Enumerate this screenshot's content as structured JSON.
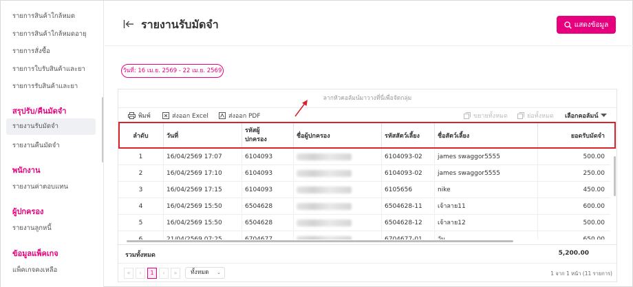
{
  "sidebar": {
    "items": [
      {
        "label": "รายการสินค้าใกล้หมด"
      },
      {
        "label": "รายการสินค้าใกล้หมดอายุ"
      },
      {
        "label": "รายการสั่งซื้อ"
      },
      {
        "label": "รายการใบรับสินค้าและยา"
      },
      {
        "label": "รายการรับสินค้าและยา"
      }
    ],
    "sections": [
      {
        "title": "สรุปรับ/คืนมัดจำ",
        "items": [
          "รายงานรับมัดจำ",
          "รายงานคืนมัดจำ"
        ]
      },
      {
        "title": "พนักงาน",
        "items": [
          "รายงานค่าตอบแทน"
        ]
      },
      {
        "title": "ผู้ปกครอง",
        "items": [
          "รายงานลูกหนี้"
        ]
      },
      {
        "title": "ข้อมูลแพ็คเกจ",
        "items": [
          "แพ็คเกจคงเหลือ"
        ]
      }
    ]
  },
  "header": {
    "title": "รายงานรับมัดจำ",
    "show_button": "แสดงข้อมูล"
  },
  "date_range": "วันที่: 16 เม.ย. 2569 - 22 เม.ย. 2569",
  "grid": {
    "group_hint": "ลากหัวคอลัมน์มาวางที่นี่เพื่อจัดกลุ่ม",
    "toolbar": {
      "print": "พิมพ์",
      "export_excel": "ส่งออก Excel",
      "export_pdf": "ส่งออก PDF",
      "expand_all": "ขยายทั้งหมด",
      "collapse_all": "ย่อทั้งหมด",
      "choose_columns": "เลือกคอลัมน์"
    },
    "columns": [
      "ลำดับ",
      "วันที่",
      "รหัสผู้ปกครอง",
      "ชื่อผู้ปกครอง",
      "รหัสสัตว์เลี้ยง",
      "ชื่อสัตว์เลี้ยง",
      "ยอดรับมัดจำ"
    ],
    "rows": [
      {
        "no": "1",
        "date": "16/04/2569 17:07",
        "guardian_code": "6104093",
        "pet_code": "6104093-02",
        "pet_name": "james swaggor5555",
        "amount": "500.00"
      },
      {
        "no": "2",
        "date": "16/04/2569 17:10",
        "guardian_code": "6104093",
        "pet_code": "6104093-02",
        "pet_name": "james swaggor5555",
        "amount": "250.00"
      },
      {
        "no": "3",
        "date": "16/04/2569 17:15",
        "guardian_code": "6104093",
        "pet_code": "6105656",
        "pet_name": "nike",
        "amount": "450.00"
      },
      {
        "no": "4",
        "date": "16/04/2569 15:50",
        "guardian_code": "6504628",
        "pet_code": "6504628-11",
        "pet_name": "เจ้าลาย11",
        "amount": "600.00"
      },
      {
        "no": "5",
        "date": "16/04/2569 15:50",
        "guardian_code": "6504628",
        "pet_code": "6504628-12",
        "pet_name": "เจ้าลาย12",
        "amount": "500.00"
      },
      {
        "no": "6",
        "date": "21/04/2569 07:25",
        "guardian_code": "6704677",
        "pet_code": "6704677-01",
        "pet_name": "วัน",
        "amount": "650.00"
      }
    ],
    "total_label": "รวมทั้งหมด",
    "total_value": "5,200.00",
    "pager": {
      "first": "«",
      "prev": "‹",
      "current": "1",
      "next": "›",
      "last": "»",
      "page_size": "ทั้งหมด",
      "info": "1 จาก 1 หน้า (11 รายการ)"
    }
  },
  "colors": {
    "accent": "#e6007e",
    "highlight": "#d8222a"
  }
}
